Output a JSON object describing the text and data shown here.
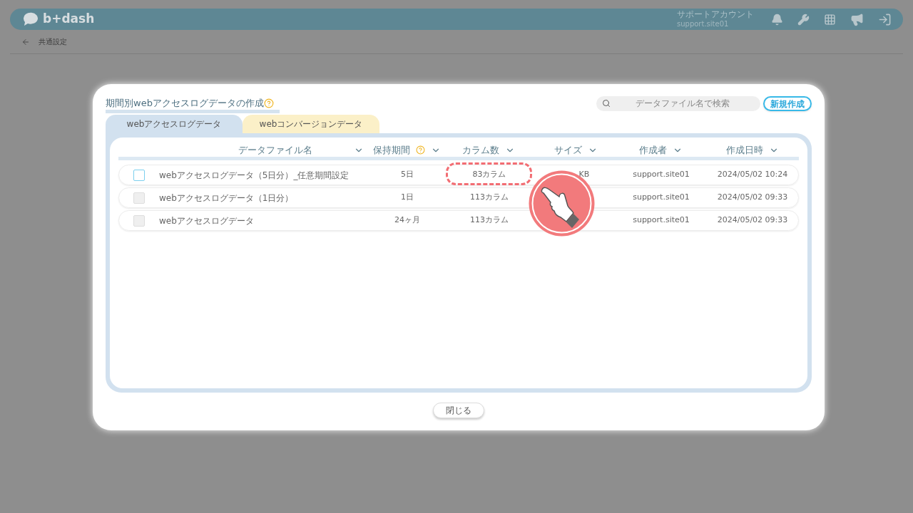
{
  "header": {
    "logo": "b+dash",
    "account_label": "サポートアカウント",
    "account_id": "support.site01"
  },
  "breadcrumb": {
    "label": "共通設定"
  },
  "modal": {
    "title": "期間別webアクセスログデータの作成",
    "search": {
      "placeholder": "データファイル名で検索"
    },
    "new_button": "新規作成",
    "tabs": [
      {
        "label": "webアクセスログデータ",
        "selected": true
      },
      {
        "label": "webコンバージョンデータ",
        "selected": false
      }
    ],
    "columns": [
      {
        "label": "データファイル名",
        "help": false
      },
      {
        "label": "保持期間",
        "help": true
      },
      {
        "label": "カラム数",
        "help": false
      },
      {
        "label": "サイズ",
        "help": false
      },
      {
        "label": "作成者",
        "help": false
      },
      {
        "label": "作成日時",
        "help": false
      }
    ],
    "rows": [
      {
        "disabled": false,
        "name": "webアクセスログデータ（5日分）_任意期間設定",
        "period": "5日",
        "columns": "83カラム",
        "size": "KB",
        "author": "support.site01",
        "created": "2024/05/02 10:24"
      },
      {
        "disabled": true,
        "name": "webアクセスログデータ（1日分）",
        "period": "1日",
        "columns": "113カラム",
        "author": "support.site01",
        "created": "2024/05/02 09:33"
      },
      {
        "disabled": true,
        "name": "webアクセスログデータ",
        "period": "24ヶ月",
        "columns": "113カラム",
        "author": "support.site01",
        "created": "2024/05/02 09:33"
      }
    ],
    "close_button": "閉じる"
  }
}
